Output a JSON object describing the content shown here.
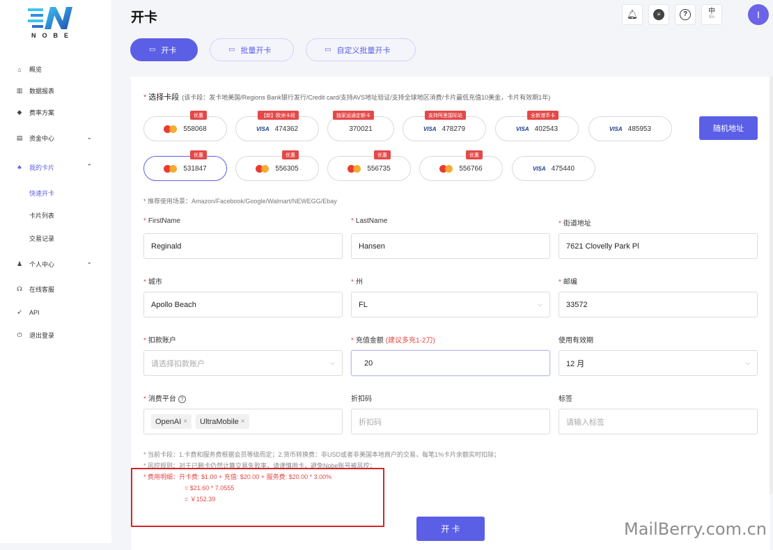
{
  "brand": {
    "name": "NOBE"
  },
  "sidebar": {
    "items": [
      {
        "label": "概览",
        "icon": "home-icon"
      },
      {
        "label": "数据报表",
        "icon": "chart-icon"
      },
      {
        "label": "费率方案",
        "icon": "diamond-icon"
      },
      {
        "label": "资金中心",
        "icon": "wallet-icon"
      },
      {
        "label": "我的卡片",
        "icon": "card-icon"
      },
      {
        "label": "快速开卡"
      },
      {
        "label": "卡片列表"
      },
      {
        "label": "交易记录"
      },
      {
        "label": "个人中心",
        "icon": "user-icon"
      },
      {
        "label": "在线客服",
        "icon": "support-icon"
      },
      {
        "label": "API",
        "icon": "rocket-icon"
      },
      {
        "label": "退出登录",
        "icon": "power-icon"
      }
    ]
  },
  "header": {
    "title": "开卡",
    "lang_label": "中",
    "lang_sub": "En",
    "avatar": "I"
  },
  "tabs": [
    {
      "label": "开卡"
    },
    {
      "label": "批量开卡"
    },
    {
      "label": "自定义批量开卡"
    }
  ],
  "segment": {
    "label": "选择卡段",
    "note": "(该卡段：发卡地美国/Regions Bank银行发行/Credit card/支持AVS地址验证/支持全球地区消费/卡片最低充值10美金，卡片有效期1年)",
    "cards": [
      {
        "bin": "558068",
        "brand": "mastercard",
        "badge": "优惠"
      },
      {
        "bin": "474362",
        "brand": "visa",
        "badge": "【新】欧洲卡段"
      },
      {
        "bin": "370021",
        "brand": "amex",
        "badge": "独家运通定额卡"
      },
      {
        "bin": "478279",
        "brand": "visa",
        "badge": "支持阿里国际站"
      },
      {
        "bin": "402543",
        "brand": "visa",
        "badge": "全新港币卡"
      },
      {
        "bin": "485953",
        "brand": "visa",
        "badge": ""
      },
      {
        "bin": "531847",
        "brand": "mastercard",
        "badge": "优惠",
        "selected": true
      },
      {
        "bin": "556305",
        "brand": "mastercard",
        "badge": "优惠"
      },
      {
        "bin": "556735",
        "brand": "mastercard",
        "badge": "优惠"
      },
      {
        "bin": "556766",
        "brand": "mastercard",
        "badge": "优惠"
      },
      {
        "bin": "475440",
        "brand": "visa",
        "badge": ""
      }
    ],
    "visa_text": "VISA",
    "random_button": "随机地址",
    "hint": "* 推荐使用场景：Amazon/Facebook/Google/Walmart/NEWEGG/Ebay"
  },
  "form": {
    "firstname": {
      "label": "FirstName",
      "value": "Reginald"
    },
    "lastname": {
      "label": "LastName",
      "value": "Hansen"
    },
    "street": {
      "label": "街道地址",
      "value": "7621 Clovelly Park Pl"
    },
    "city": {
      "label": "城市",
      "value": "Apollo Beach"
    },
    "state": {
      "label": "州",
      "value": "FL"
    },
    "zip": {
      "label": "邮编",
      "value": "33572"
    },
    "account": {
      "label": "扣款账户",
      "placeholder": "请选择扣款账户"
    },
    "amount": {
      "label": "充值金额",
      "sub": "(建议多充1-2刀)",
      "value": "20"
    },
    "validity": {
      "label": "使用有效期",
      "value": "12 月"
    },
    "platform": {
      "label": "消费平台",
      "tags": [
        "OpenAI",
        "UltraMobile"
      ]
    },
    "discount": {
      "label": "折扣码",
      "placeholder": "折扣码"
    },
    "tag": {
      "label": "标签",
      "placeholder": "请输入标签"
    }
  },
  "notes": {
    "line1": "* 当前卡段：1.卡费和服务费根据会员等级而定；2.货币转换费：非USD或者非美国本地商户的交易，每笔1%卡片余额实时扣除；",
    "line2": "* 风控规则：对于已删卡仍然计算交易失败率，请谨慎用卡，避免Nobe账号被风控；",
    "fee1": "* 费用明细：开卡费: $1.00 + 充值: $20.00 + 服务费: $20.00 * 3.00%",
    "fee2": "= $21.60 * 7.0555",
    "fee3": "= ￥152.39"
  },
  "submit_label": "开 卡",
  "watermark": "MailBerry.com.cn",
  "colors": {
    "accent": "#5b5fe6",
    "danger": "#e54848"
  }
}
